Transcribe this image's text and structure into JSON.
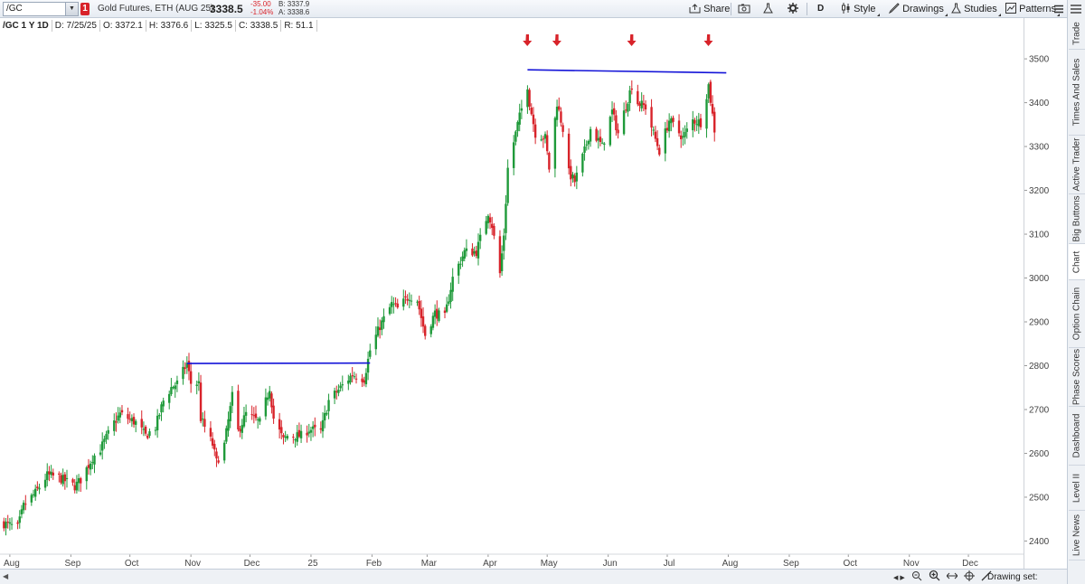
{
  "toolbar": {
    "symbol": "/GC",
    "alert_count": "1",
    "description": "Gold Futures, ETH (AUG 25)",
    "last_price": "3338.5",
    "net_change": "-35.00",
    "pct_change": "-1.04%",
    "bid": "B: 3337.9",
    "ask": "A: 3338.6",
    "share_label": "Share",
    "aggregation": "D",
    "style_label": "Style",
    "drawings_label": "Drawings",
    "studies_label": "Studies",
    "patterns_label": "Patterns"
  },
  "infobar": {
    "symbol_period": "/GC 1 Y 1D",
    "date": "D: 7/25/25",
    "open": "O: 3372.1",
    "high": "H: 3376.6",
    "low": "L: 3325.5",
    "close": "C: 3338.5",
    "range": "R: 51.1"
  },
  "sidebar": {
    "tabs": [
      {
        "label": "Trade",
        "active": false
      },
      {
        "label": "Times And Sales",
        "active": false
      },
      {
        "label": "Active Trader",
        "active": false
      },
      {
        "label": "Big Buttons",
        "active": false
      },
      {
        "label": "Chart",
        "active": true
      },
      {
        "label": "Option Chain",
        "active": false
      },
      {
        "label": "Phase Scores",
        "active": false
      },
      {
        "label": "Dashboard",
        "active": false
      },
      {
        "label": "Level II",
        "active": false
      },
      {
        "label": "Live News",
        "active": false
      }
    ]
  },
  "bottombar": {
    "drawing_set": "Drawing set: Default"
  },
  "colors": {
    "up": "#1f9a3a",
    "down": "#d8232a",
    "trendline": "#1414d8",
    "marker": "#d8232a"
  },
  "chart_data": {
    "type": "candlestick",
    "title": "",
    "xlabel": "",
    "ylabel": "",
    "ylim": [
      2370,
      3560
    ],
    "xlim": [
      "2024-07-27",
      "2025-12-29"
    ],
    "y_ticks": [
      2400,
      2500,
      2600,
      2700,
      2800,
      2900,
      3000,
      3100,
      3200,
      3300,
      3400,
      3500
    ],
    "x_ticks": [
      {
        "label": "Aug",
        "date": "2024-08-01"
      },
      {
        "label": "Sep",
        "date": "2024-09-01"
      },
      {
        "label": "Oct",
        "date": "2024-10-01"
      },
      {
        "label": "Nov",
        "date": "2024-11-01"
      },
      {
        "label": "Dec",
        "date": "2024-12-01"
      },
      {
        "label": "25",
        "date": "2025-01-01"
      },
      {
        "label": "Feb",
        "date": "2025-02-01"
      },
      {
        "label": "Mar",
        "date": "2025-03-01"
      },
      {
        "label": "Apr",
        "date": "2025-04-01"
      },
      {
        "label": "May",
        "date": "2025-05-01"
      },
      {
        "label": "Jun",
        "date": "2025-06-01"
      },
      {
        "label": "Jul",
        "date": "2025-07-01"
      },
      {
        "label": "Aug",
        "date": "2025-08-01"
      },
      {
        "label": "Sep",
        "date": "2025-09-01"
      },
      {
        "label": "Oct",
        "date": "2025-10-01"
      },
      {
        "label": "Nov",
        "date": "2025-11-01"
      },
      {
        "label": "Dec",
        "date": "2025-12-01"
      }
    ],
    "close_path": [
      [
        "2024-07-29",
        2440
      ],
      [
        "2024-08-05",
        2430
      ],
      [
        "2024-08-08",
        2480
      ],
      [
        "2024-08-14",
        2510
      ],
      [
        "2024-08-20",
        2550
      ],
      [
        "2024-08-26",
        2545
      ],
      [
        "2024-09-03",
        2525
      ],
      [
        "2024-09-06",
        2540
      ],
      [
        "2024-09-12",
        2590
      ],
      [
        "2024-09-16",
        2610
      ],
      [
        "2024-09-23",
        2670
      ],
      [
        "2024-09-26",
        2690
      ],
      [
        "2024-09-30",
        2680
      ],
      [
        "2024-10-04",
        2670
      ],
      [
        "2024-10-09",
        2640
      ],
      [
        "2024-10-14",
        2660
      ],
      [
        "2024-10-18",
        2720
      ],
      [
        "2024-10-22",
        2750
      ],
      [
        "2024-10-25",
        2760
      ],
      [
        "2024-10-30",
        2805
      ],
      [
        "2024-11-01",
        2760
      ],
      [
        "2024-11-05",
        2760
      ],
      [
        "2024-11-06",
        2680
      ],
      [
        "2024-11-12",
        2620
      ],
      [
        "2024-11-14",
        2580
      ],
      [
        "2024-11-18",
        2620
      ],
      [
        "2024-11-22",
        2730
      ],
      [
        "2024-11-25",
        2650
      ],
      [
        "2024-11-29",
        2690
      ],
      [
        "2024-12-06",
        2670
      ],
      [
        "2024-12-11",
        2750
      ],
      [
        "2024-12-13",
        2680
      ],
      [
        "2024-12-18",
        2630
      ],
      [
        "2024-12-20",
        2640
      ],
      [
        "2024-12-27",
        2640
      ],
      [
        "2024-12-31",
        2655
      ],
      [
        "2025-01-06",
        2650
      ],
      [
        "2025-01-10",
        2720
      ],
      [
        "2025-01-16",
        2750
      ],
      [
        "2025-01-22",
        2780
      ],
      [
        "2025-01-28",
        2770
      ],
      [
        "2025-01-31",
        2835
      ],
      [
        "2025-02-05",
        2890
      ],
      [
        "2025-02-11",
        2940
      ],
      [
        "2025-02-14",
        2930
      ],
      [
        "2025-02-20",
        2960
      ],
      [
        "2025-02-24",
        2950
      ],
      [
        "2025-02-28",
        2870
      ],
      [
        "2025-03-05",
        2920
      ],
      [
        "2025-03-10",
        2910
      ],
      [
        "2025-03-14",
        3000
      ],
      [
        "2025-03-20",
        3060
      ],
      [
        "2025-03-26",
        3060
      ],
      [
        "2025-04-01",
        3150
      ],
      [
        "2025-04-03",
        3120
      ],
      [
        "2025-04-07",
        3010
      ],
      [
        "2025-04-09",
        3100
      ],
      [
        "2025-04-11",
        3250
      ],
      [
        "2025-04-16",
        3350
      ],
      [
        "2025-04-21",
        3440
      ],
      [
        "2025-04-22",
        3400
      ],
      [
        "2025-04-25",
        3330
      ],
      [
        "2025-04-30",
        3320
      ],
      [
        "2025-05-02",
        3250
      ],
      [
        "2025-05-06",
        3400
      ],
      [
        "2025-05-09",
        3340
      ],
      [
        "2025-05-12",
        3240
      ],
      [
        "2025-05-15",
        3220
      ],
      [
        "2025-05-20",
        3290
      ],
      [
        "2025-05-23",
        3340
      ],
      [
        "2025-05-29",
        3300
      ],
      [
        "2025-06-03",
        3380
      ],
      [
        "2025-06-06",
        3330
      ],
      [
        "2025-06-13",
        3440
      ],
      [
        "2025-06-16",
        3400
      ],
      [
        "2025-06-20",
        3390
      ],
      [
        "2025-06-24",
        3330
      ],
      [
        "2025-06-27",
        3290
      ],
      [
        "2025-07-02",
        3360
      ],
      [
        "2025-07-09",
        3320
      ],
      [
        "2025-07-14",
        3360
      ],
      [
        "2025-07-18",
        3355
      ],
      [
        "2025-07-22",
        3440
      ],
      [
        "2025-07-25",
        3338
      ]
    ],
    "trendlines": [
      {
        "from": [
          "2024-10-30",
          2805
        ],
        "to": [
          "2025-01-31",
          2806
        ]
      },
      {
        "from": [
          "2025-04-21",
          3475
        ],
        "to": [
          "2025-07-31",
          3468
        ]
      }
    ],
    "markers": [
      {
        "date": "2025-04-21",
        "shape": "down-arrow"
      },
      {
        "date": "2025-05-06",
        "shape": "down-arrow"
      },
      {
        "date": "2025-06-13",
        "shape": "down-arrow"
      },
      {
        "date": "2025-07-22",
        "shape": "down-arrow"
      }
    ]
  }
}
